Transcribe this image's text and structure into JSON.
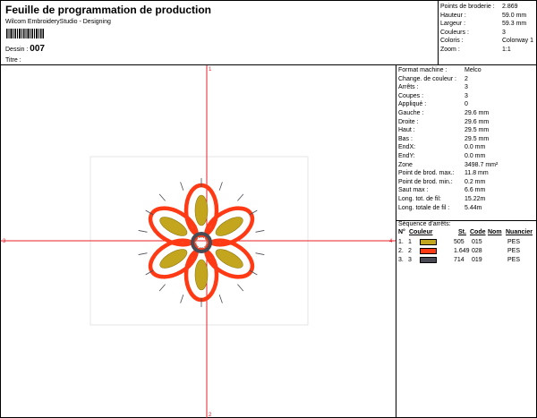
{
  "header": {
    "title": "Feuille de programmation de production",
    "subtitle": "Wilcom EmbroideryStudio - Designing",
    "dessin_label": "Dessin :",
    "dessin_value": "007",
    "titre_label": "Titre :",
    "stats": [
      {
        "label": "Points de broderie :",
        "value": "2.869"
      },
      {
        "label": "Hauteur :",
        "value": "59.0 mm"
      },
      {
        "label": "Largeur :",
        "value": "59.3 mm"
      },
      {
        "label": "Couleurs :",
        "value": "3"
      },
      {
        "label": "Coloris :",
        "value": "Colorway 1"
      },
      {
        "label": "Zoom :",
        "value": "1:1"
      }
    ]
  },
  "canvas": {
    "top_marker": "1",
    "bottom_marker": "2",
    "left_marker": "3",
    "right_marker": "4",
    "colors": {
      "crosshair": "#e8202a",
      "frame": "#e6e6e6"
    }
  },
  "info": [
    {
      "label": "Format machine :",
      "value": "Melco"
    },
    {
      "label": "Change. de couleur :",
      "value": "2"
    },
    {
      "label": "Arrêts :",
      "value": "3"
    },
    {
      "label": "Coupes :",
      "value": "3"
    },
    {
      "label": "Appliqué :",
      "value": "0"
    },
    {
      "label": "Gauche :",
      "value": "29.6 mm"
    },
    {
      "label": "Droite :",
      "value": "29.6 mm"
    },
    {
      "label": "Haut :",
      "value": "29.5 mm"
    },
    {
      "label": "Bas :",
      "value": "29.5 mm"
    },
    {
      "label": "EndX:",
      "value": "0.0 mm"
    },
    {
      "label": "EndY:",
      "value": "0.0 mm"
    },
    {
      "label": "Zone",
      "value": "3498.7 mm²"
    },
    {
      "label": "Point de brod. max.:",
      "value": "11.8 mm"
    },
    {
      "label": "Point de brod. min.:",
      "value": "0.2 mm"
    },
    {
      "label": "Saut max :",
      "value": "6.6 mm"
    },
    {
      "label": "Long. tot. de fil:",
      "value": "15.22m"
    },
    {
      "label": "Long. totale de fil :",
      "value": "5.44m"
    }
  ],
  "sequence": {
    "title": "Séquence d'arrêts:",
    "headers": {
      "n": "N°",
      "couleur": "Couleur",
      "st": "St.",
      "code": "Code",
      "nom": "Nom",
      "nuancier": "Nuancier"
    },
    "rows": [
      {
        "n": "1.",
        "idx": "1",
        "color": "#c3a51e",
        "st": "505",
        "code": "015",
        "nuancier": "PES"
      },
      {
        "n": "2.",
        "idx": "2",
        "color": "#ff3a14",
        "st": "1.649",
        "code": "028",
        "nuancier": "PES"
      },
      {
        "n": "3.",
        "idx": "3",
        "color": "#4a4a55",
        "st": "714",
        "code": "019",
        "nuancier": "PES"
      }
    ]
  }
}
